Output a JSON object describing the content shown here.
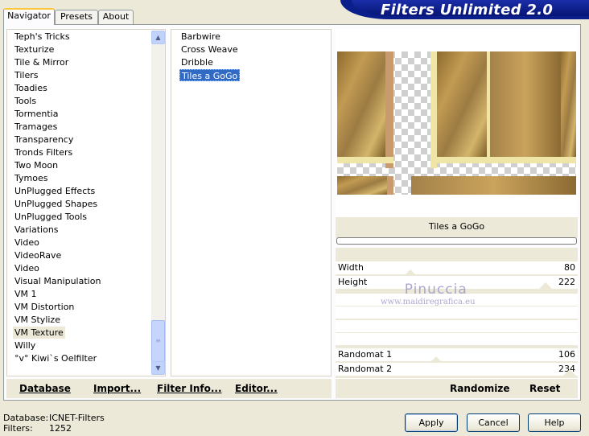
{
  "tabs": [
    "Navigator",
    "Presets",
    "About"
  ],
  "banner_title": "Filters Unlimited 2.0",
  "categories": [
    "Teph's Tricks",
    "Texturize",
    "Tile & Mirror",
    "Tilers",
    "Toadies",
    "Tools",
    "Tormentia",
    "Tramages",
    "Transparency",
    "Tronds Filters",
    "Two Moon",
    "Tymoes",
    "UnPlugged Effects",
    "UnPlugged Shapes",
    "UnPlugged Tools",
    "Variations",
    "Video",
    "VideoRave",
    "Video",
    "Visual Manipulation",
    "VM 1",
    "VM Distortion",
    "VM Stylize",
    "VM Texture",
    "Willy",
    "°v° Kiwi`s Oelfilter"
  ],
  "selected_category": "VM Texture",
  "filters": [
    "Barbwire",
    "Cross Weave",
    "Dribble",
    "Tiles a GoGo"
  ],
  "selected_filter": "Tiles a GoGo",
  "current_filter_name": "Tiles a GoGo",
  "params": [
    {
      "label": "Width",
      "value": "80"
    },
    {
      "label": "Height",
      "value": "222"
    },
    {
      "label": "",
      "value": ""
    },
    {
      "label": "",
      "value": ""
    },
    {
      "label": "",
      "value": ""
    },
    {
      "label": "",
      "value": ""
    },
    {
      "label": "Randomat 1",
      "value": "106"
    },
    {
      "label": "Randomat 2",
      "value": "234"
    }
  ],
  "bottom_left": {
    "database": "Database",
    "import": "Import...",
    "filter_info": "Filter Info...",
    "editor": "Editor..."
  },
  "bottom_right": {
    "randomize": "Randomize",
    "reset": "Reset"
  },
  "status": {
    "database_label": "Database:",
    "database_value": "ICNET-Filters",
    "filters_label": "Filters:",
    "filters_value": "1252"
  },
  "buttons": {
    "apply": "Apply",
    "cancel": "Cancel",
    "help": "Help"
  },
  "watermark": {
    "name": "Pinuccia",
    "url": "www.maidiregrafica.eu"
  }
}
